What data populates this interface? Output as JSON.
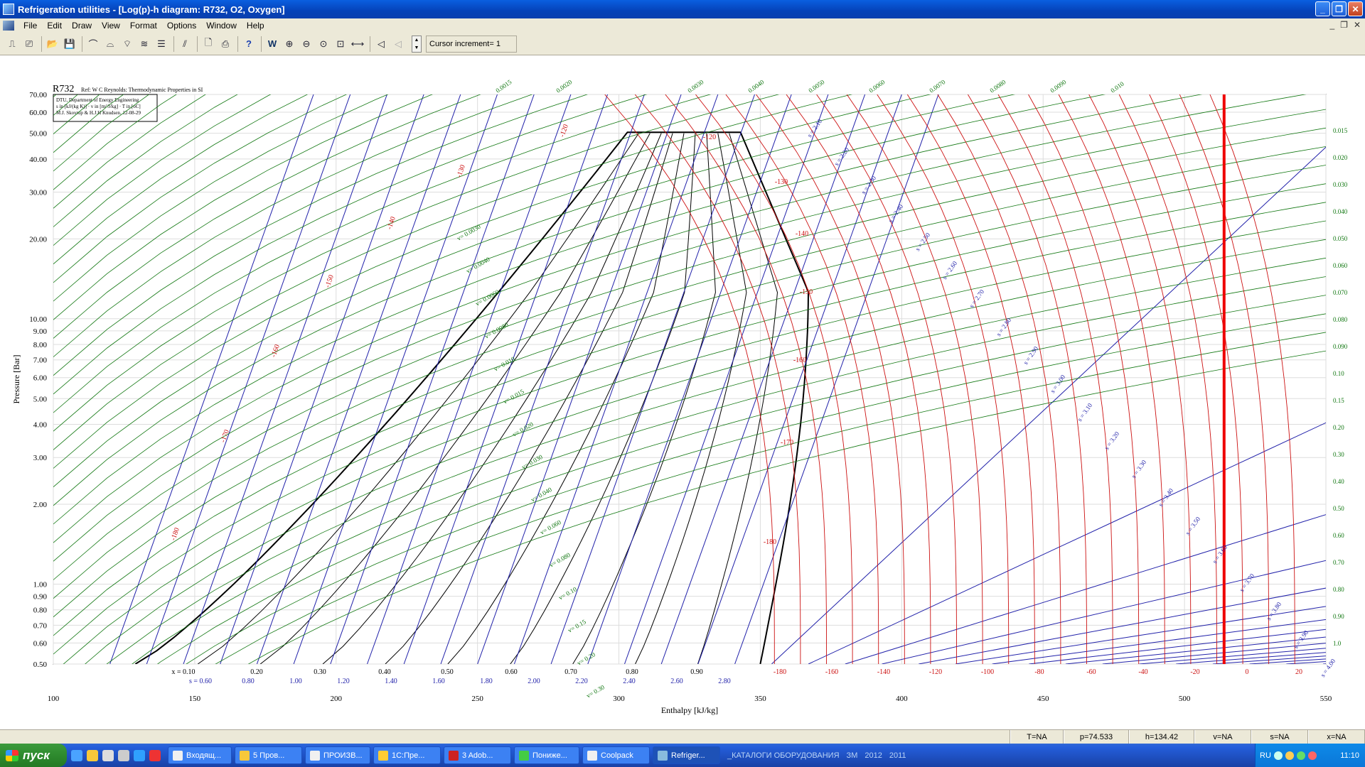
{
  "window": {
    "title": "Refrigeration utilities - [Log(p)-h diagram: R732, O2, Oxygen]"
  },
  "menu": [
    "File",
    "Edit",
    "Draw",
    "View",
    "Format",
    "Options",
    "Window",
    "Help"
  ],
  "toolbar": {
    "cursor_increment": "Cursor increment= 1"
  },
  "chart": {
    "refrigerant": "R732",
    "ref_note": "Ref: W C Reynolds: Thermodynamic Properties in SI",
    "box_lines": [
      "DTU, Department of Energy Engineering",
      "s in [kJ/(kg K)] · v in [m^3/kg] · T in [oC]",
      "M.J. Skovrup & H.J.H Knudsen. 12-08-29"
    ],
    "ylabel": "Pressure [Bar]",
    "xlabel": "Enthalpy [kJ/kg]",
    "y_ticks": [
      "0.50",
      "0.60",
      "0.70",
      "0.80",
      "0.90",
      "1.00",
      "2.00",
      "3.00",
      "4.00",
      "5.00",
      "6.00",
      "7.00",
      "8.00",
      "9.00",
      "10.00",
      "20.00",
      "30.00",
      "40.00",
      "50.00",
      "60.00",
      "70.00"
    ],
    "x_ticks": [
      "100",
      "150",
      "200",
      "250",
      "300",
      "350",
      "400",
      "450",
      "500",
      "550"
    ],
    "quality_labels": [
      "x = 0.10",
      "0.20",
      "0.30",
      "0.40",
      "0.50",
      "0.60",
      "0.70",
      "0.80",
      "0.90"
    ],
    "entropy_bottom_labels": [
      "s = 0.60",
      "0.80",
      "1.00",
      "1.20",
      "1.40",
      "1.60",
      "1.80",
      "2.00",
      "2.20",
      "2.40",
      "2.60",
      "2.80"
    ],
    "temp_bottom_labels": [
      "-180",
      "-160",
      "-140",
      "-120",
      "-100",
      "-80",
      "-60",
      "-40",
      "-20",
      "0",
      "20"
    ],
    "sat_temp_labels": [
      "-120",
      "-130",
      "-140",
      "-150",
      "-160",
      "-170",
      "-180"
    ],
    "liquid_temp_labels": [
      "-120",
      "-130",
      "-140",
      "-150",
      "-160",
      "-170",
      "-180"
    ],
    "entropy_labels": [
      "s = 2.10",
      "s = 2.20",
      "s = 2.30",
      "s = 2.40",
      "s = 2.50",
      "s = 2.60",
      "s = 2.70",
      "s = 2.80",
      "s = 2.90",
      "s = 3.00",
      "s = 3.10",
      "s = 3.20",
      "s = 3.30",
      "s = 3.40",
      "s = 3.50",
      "s = 3.60",
      "s = 3.70",
      "s = 3.80",
      "s = 3.90",
      "s = 4.00"
    ],
    "volume_top_labels": [
      "0.0015",
      "0.0020",
      "0.0030",
      "0.0040",
      "0.0050",
      "0.0060",
      "0.0070",
      "0.0080",
      "0.0090",
      "0.010"
    ],
    "volume_right_labels": [
      "0.015",
      "0.020",
      "0.030",
      "0.040",
      "0.050",
      "0.060",
      "0.070",
      "0.080",
      "0.090",
      "0.10",
      "0.15",
      "0.20",
      "0.30",
      "0.40",
      "0.50",
      "0.60",
      "0.70",
      "0.80",
      "0.90",
      "1.0"
    ],
    "volume_inner_labels": [
      "v= 0.0030",
      "v= 0.0040",
      "v= 0.0060",
      "v= 0.0080",
      "v= 0.010",
      "v= 0.015",
      "v= 0.020",
      "v= 0.030",
      "v= 0.040",
      "v= 0.060",
      "v= 0.080",
      "v= 0.10",
      "v= 0.15",
      "v= 0.20",
      "v= 0.30"
    ],
    "colors": {
      "isotherm": "#cc1111",
      "isentrope": "#2222aa",
      "isochore": "#117711",
      "dome": "#000000",
      "cursor": "#ee0000"
    }
  },
  "statusbar": {
    "T": "T=NA",
    "p": "p=74.533",
    "h": "h=134.42",
    "v": "v=NA",
    "s": "s=NA",
    "x": "x=NA"
  },
  "taskbar": {
    "start": "пуск",
    "tasks": [
      "Входящ...",
      "5 Пров...",
      "ПРОИЗВ...",
      "1С:Пре...",
      "3 Adob...",
      "Пониже...",
      "Coolpack",
      "Refriger..."
    ],
    "extra_labels": [
      "_КАТАЛОГИ ОБОРУДОВАНИЯ",
      "ЗМ",
      "2012",
      "2011"
    ],
    "lang": "RU",
    "clock": "11:10"
  }
}
